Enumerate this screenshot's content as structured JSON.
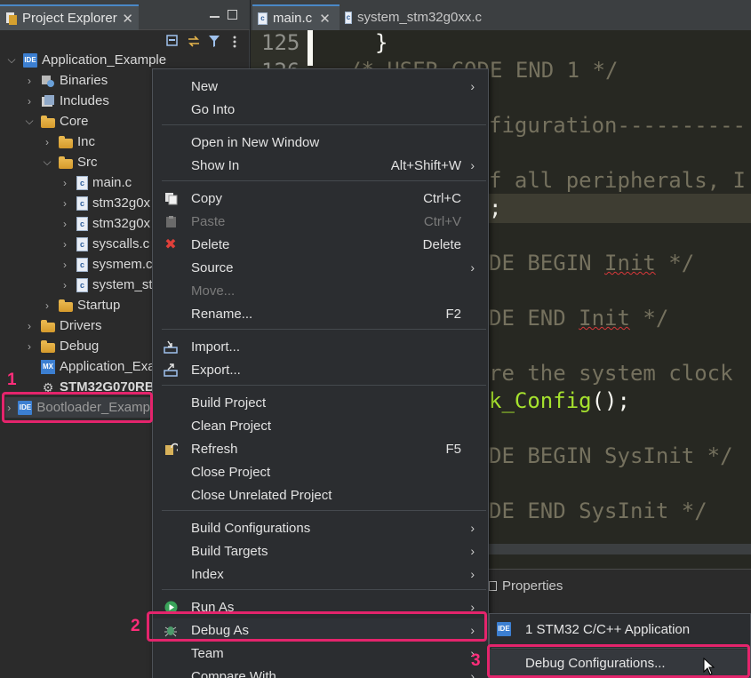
{
  "explorer": {
    "title": "Project Explorer",
    "close": "✕",
    "tree": [
      {
        "label": "Application_Example",
        "icon": "ide",
        "arrow": "⌵"
      },
      {
        "label": "Binaries",
        "icon": "binaries",
        "arrow": "›"
      },
      {
        "label": "Includes",
        "icon": "includes",
        "arrow": "›"
      },
      {
        "label": "Core",
        "icon": "folder",
        "arrow": "⌵"
      },
      {
        "label": "Inc",
        "icon": "folder",
        "arrow": "›"
      },
      {
        "label": "Src",
        "icon": "folder",
        "arrow": "⌵"
      },
      {
        "label": "main.c",
        "icon": "c",
        "arrow": "›"
      },
      {
        "label": "stm32g0x",
        "icon": "c",
        "arrow": "›"
      },
      {
        "label": "stm32g0x",
        "icon": "c",
        "arrow": "›"
      },
      {
        "label": "syscalls.c",
        "icon": "c",
        "arrow": "›"
      },
      {
        "label": "sysmem.c",
        "icon": "c",
        "arrow": "›"
      },
      {
        "label": "system_str",
        "icon": "c",
        "arrow": "›"
      },
      {
        "label": "Startup",
        "icon": "folder",
        "arrow": "›"
      },
      {
        "label": "Drivers",
        "icon": "folder",
        "arrow": "›"
      },
      {
        "label": "Debug",
        "icon": "folder",
        "arrow": "›"
      },
      {
        "label": "Application_Exa",
        "icon": "mx",
        "arrow": ""
      },
      {
        "label": "STM32G070RB",
        "icon": "gear",
        "arrow": ""
      },
      {
        "label": "Bootloader_Examp",
        "icon": "ide",
        "arrow": "›"
      }
    ]
  },
  "editor": {
    "tabs": [
      {
        "label": "main.c",
        "close": "✕"
      },
      {
        "label": "system_stm32g0xx.c"
      }
    ],
    "line_numbers": [
      "125",
      "126"
    ],
    "code": {
      "l1": "}",
      "l2": "/* USER CODE END 1 */",
      "l3": "figuration----------",
      "l4": "f all peripherals, I",
      "l5": ";",
      "l6a": "DE BEGIN ",
      "l6b": "Init",
      "l6c": " */",
      "l7a": "DE END ",
      "l7b": "Init",
      "l7c": " */",
      "l8": "re the system clock",
      "l9a": "k_Config",
      "l9b": "();",
      "l10": "DE BEGIN SysInit */",
      "l11": "DE END SysInit */"
    }
  },
  "properties": {
    "title": "Properties"
  },
  "context_menu": {
    "new": "New",
    "go_into": "Go Into",
    "open_new_window": "Open in New Window",
    "show_in": "Show In",
    "show_in_acc": "Alt+Shift+W",
    "copy": "Copy",
    "copy_acc": "Ctrl+C",
    "paste": "Paste",
    "paste_acc": "Ctrl+V",
    "delete": "Delete",
    "delete_acc": "Delete",
    "source": "Source",
    "move": "Move...",
    "rename": "Rename...",
    "rename_acc": "F2",
    "import": "Import...",
    "export": "Export...",
    "build_project": "Build Project",
    "clean_project": "Clean Project",
    "refresh": "Refresh",
    "refresh_acc": "F5",
    "close_project": "Close Project",
    "close_unrelated": "Close Unrelated Project",
    "build_configurations": "Build Configurations",
    "build_targets": "Build Targets",
    "index": "Index",
    "run_as": "Run As",
    "debug_as": "Debug As",
    "team": "Team",
    "compare_with": "Compare With",
    "submenu_arrow": "›"
  },
  "submenu": {
    "stm32_app": "1 STM32 C/C++ Application",
    "debug_configurations": "Debug Configurations..."
  },
  "annotations": {
    "step1": "1",
    "step2": "2",
    "step3": "3",
    "highlight_color": "#e4246c"
  }
}
